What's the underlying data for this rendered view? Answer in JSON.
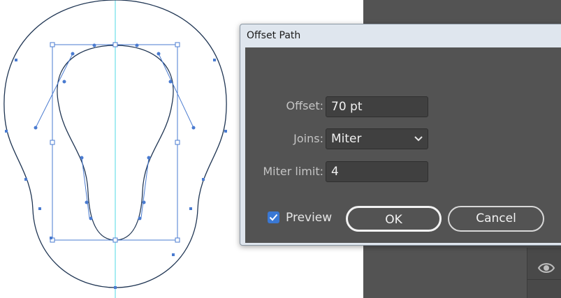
{
  "dialog": {
    "title": "Offset Path",
    "offset": {
      "label": "Offset:",
      "value": "70 pt"
    },
    "joins": {
      "label": "Joins:",
      "value": "Miter"
    },
    "miter_limit": {
      "label": "Miter limit:",
      "value": "4"
    },
    "preview": {
      "label": "Preview",
      "checked": true
    },
    "ok_label": "OK",
    "cancel_label": "Cancel"
  },
  "colors": {
    "panel_bg": "#535353",
    "field_bg": "#404040",
    "accent": "#3a78d4",
    "path_stroke": "#1f3553",
    "guide": "#4fd8e4",
    "anchor": "#4a7bd0"
  },
  "icons": {
    "visibility": "eye-icon",
    "chevron": "chevron-down-icon",
    "check": "checkmark-icon"
  }
}
